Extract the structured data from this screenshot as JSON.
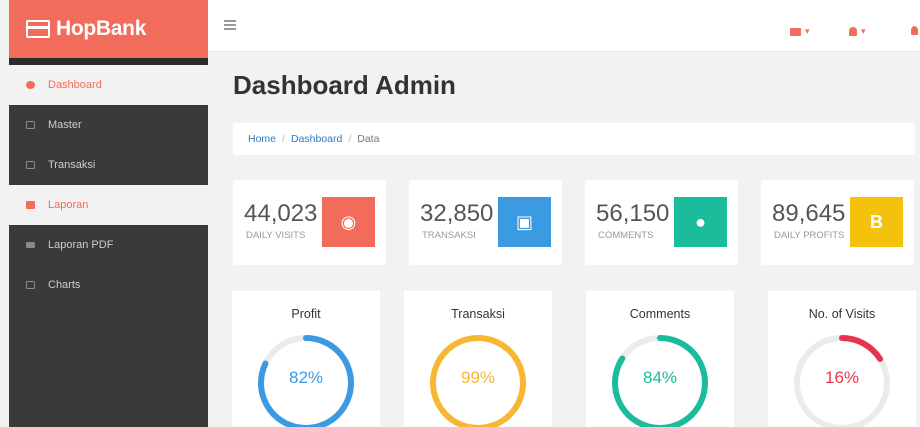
{
  "brand": {
    "name": "HopBank"
  },
  "topbar": {
    "caret": "▾"
  },
  "sidebar": {
    "items": [
      {
        "label": "Dashboard",
        "active": true
      },
      {
        "label": "Master"
      },
      {
        "label": "Transaksi"
      },
      {
        "label": "Laporan",
        "active": true
      },
      {
        "label": "Laporan PDF"
      },
      {
        "label": "Charts"
      }
    ]
  },
  "page": {
    "title": "Dashboard Admin"
  },
  "breadcrumb": {
    "home": "Home",
    "dashboard": "Dashboard",
    "current": "Data",
    "separator": "/"
  },
  "stats": [
    {
      "value": "44,023",
      "label": "DAILY VISITS",
      "icon": "eye-icon",
      "color": "#f26c5b",
      "glyph": "◉"
    },
    {
      "value": "32,850",
      "label": "TRANSAKSI",
      "icon": "money-icon",
      "color": "#3b9ae1",
      "glyph": "▣"
    },
    {
      "value": "56,150",
      "label": "COMMENTS",
      "icon": "comments-icon",
      "color": "#1abc9c",
      "glyph": "●"
    },
    {
      "value": "89,645",
      "label": "DAILY PROFITS",
      "icon": "bitcoin-icon",
      "color": "#f4c20d",
      "glyph": "B"
    }
  ],
  "gauges": [
    {
      "title": "Profit",
      "percent": 82,
      "text": "82%",
      "color": "#3b9ae1"
    },
    {
      "title": "Transaksi",
      "percent": 99,
      "text": "99%",
      "color": "#f7b733"
    },
    {
      "title": "Comments",
      "percent": 84,
      "text": "84%",
      "color": "#1abc9c"
    },
    {
      "title": "No. of Visits",
      "percent": 16,
      "text": "16%",
      "color": "#e8344c"
    }
  ]
}
